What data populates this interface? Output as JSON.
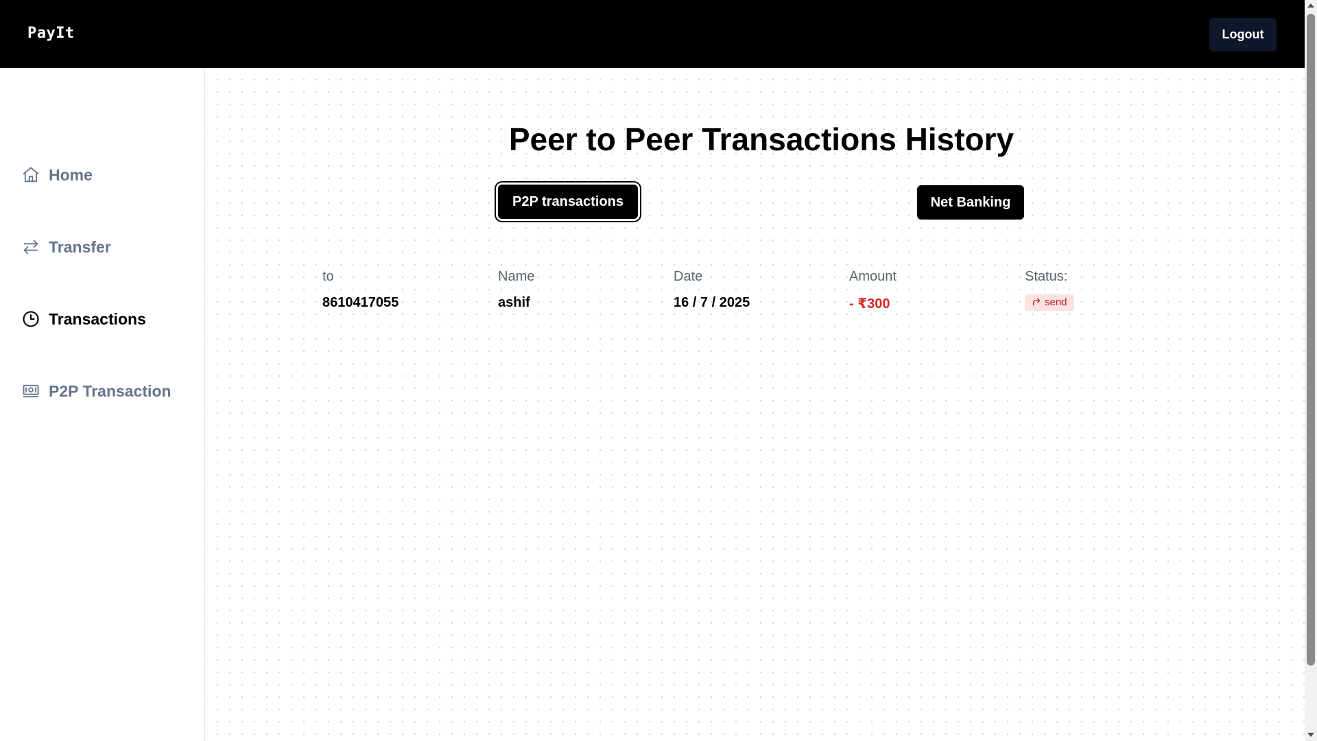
{
  "header": {
    "brand": "PayIt",
    "logout_label": "Logout"
  },
  "sidebar": {
    "items": [
      {
        "label": "Home",
        "icon": "home-icon",
        "active": false
      },
      {
        "label": "Transfer",
        "icon": "transfer-arrows-icon",
        "active": false
      },
      {
        "label": "Transactions",
        "icon": "clock-icon",
        "active": true
      },
      {
        "label": "P2P Transaction",
        "icon": "banknote-icon",
        "active": false
      }
    ]
  },
  "main": {
    "title": "Peer to Peer Transactions History",
    "tabs": [
      {
        "label": "P2P transactions",
        "selected": true
      },
      {
        "label": "Net Banking",
        "selected": false
      }
    ],
    "table": {
      "headers": [
        "to",
        "Name",
        "Date",
        "Amount",
        "Status:"
      ],
      "rows": [
        {
          "to": "8610417055",
          "name": "ashif",
          "date": "16 / 7 / 2025",
          "amount": "- ₹300",
          "status": "send",
          "status_icon": "forward-arrow-icon"
        }
      ]
    }
  },
  "colors": {
    "topbar_bg": "#000000",
    "logout_bg": "#0f172a",
    "amount_negative": "#dc2626",
    "status_badge_bg": "#fde2e2",
    "status_badge_text": "#b91c1c",
    "nav_inactive": "#64748b"
  }
}
